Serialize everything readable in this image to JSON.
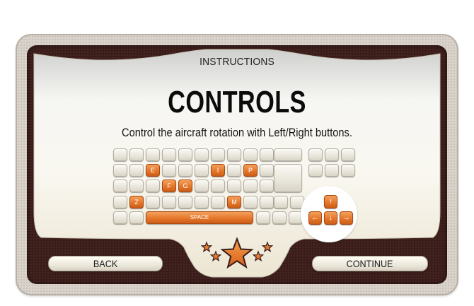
{
  "screen": {
    "label": "INSTRUCTIONS",
    "heading": "CONTROLS",
    "description": "Control the aircraft rotation with Left/Right buttons."
  },
  "keyboard": {
    "highlighted_keys": [
      "E",
      "I",
      "P",
      "F",
      "G",
      "Z",
      "M",
      "SPACE"
    ],
    "arrows": {
      "up": "↑",
      "left": "←",
      "down": "↓",
      "right": "→"
    }
  },
  "buttons": {
    "back": "BACK",
    "continue": "CONTINUE"
  },
  "colors": {
    "accent_orange": "#e5772c",
    "frame_dark": "#3a1d1a",
    "star_orange": "#e8782a"
  },
  "rating": {
    "stars": 5
  }
}
